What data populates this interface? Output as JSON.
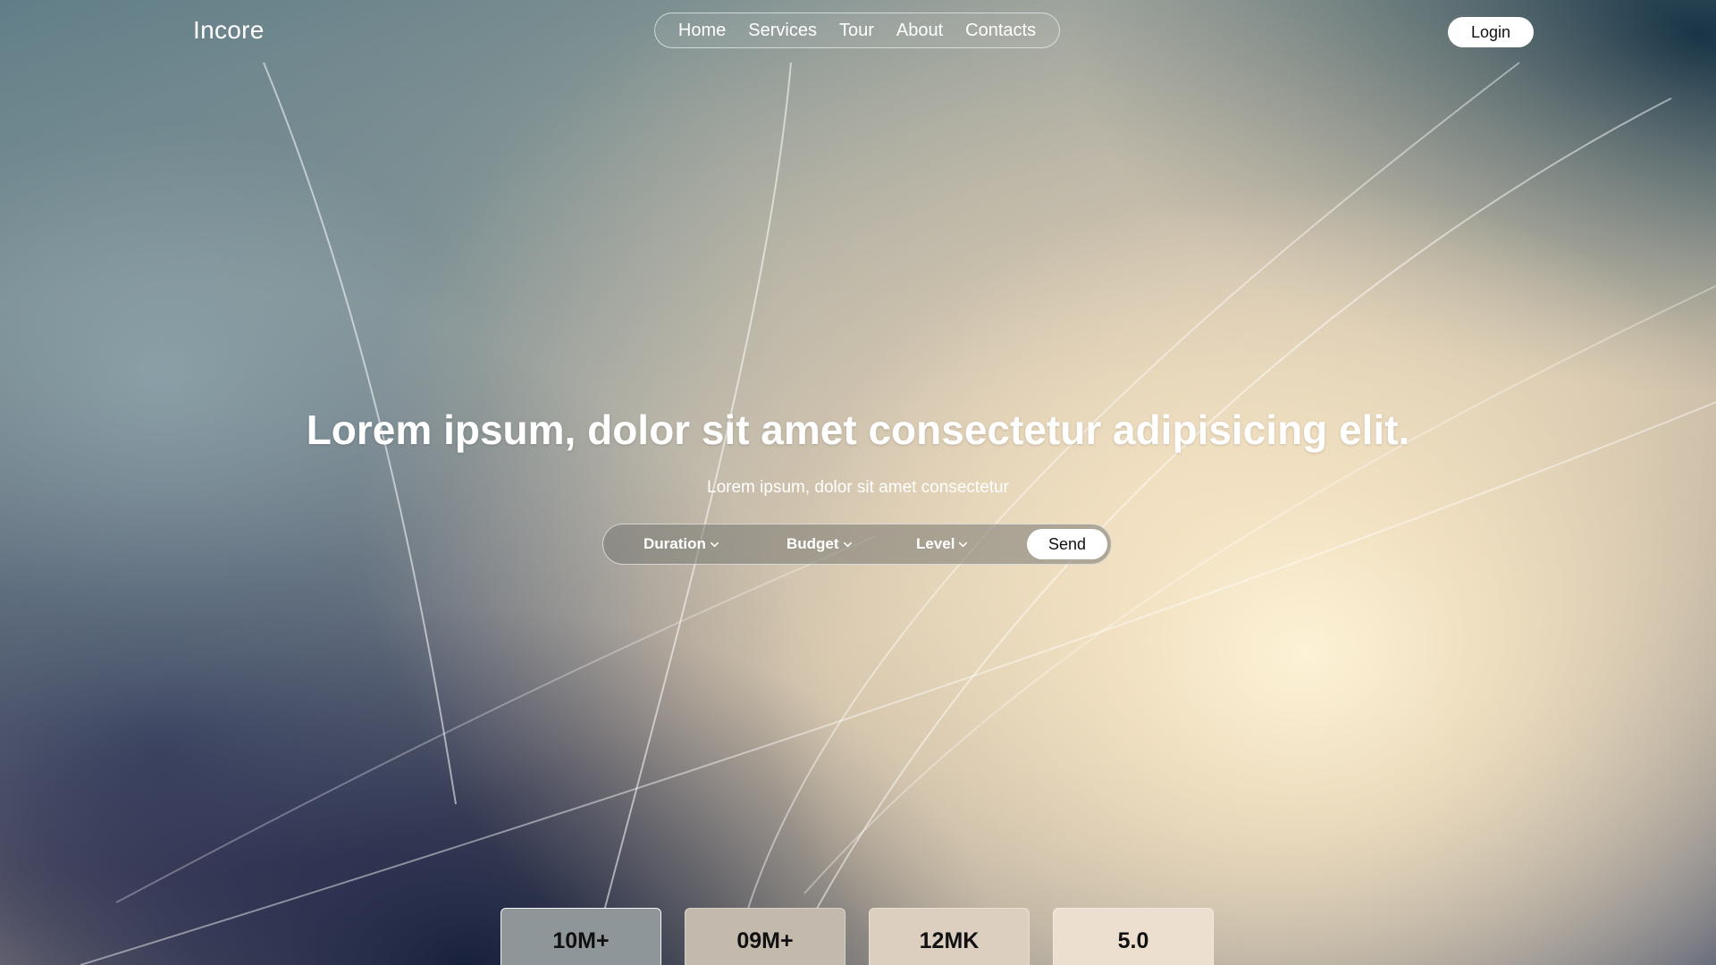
{
  "brand": {
    "logo_text": "Incore"
  },
  "nav": {
    "items": [
      {
        "label": "Home"
      },
      {
        "label": "Services"
      },
      {
        "label": "Tour"
      },
      {
        "label": "About"
      },
      {
        "label": "Contacts"
      }
    ],
    "login_label": "Login"
  },
  "hero": {
    "title": "Lorem ipsum, dolor sit amet consectetur adipisicing elit.",
    "subtitle": "Lorem ipsum, dolor sit amet consectetur"
  },
  "search": {
    "filters": [
      {
        "label": "Duration",
        "icon": "chevron-down-icon"
      },
      {
        "label": "Budget",
        "icon": "chevron-down-icon"
      },
      {
        "label": "Level",
        "icon": "chevron-down-icon"
      }
    ],
    "send_label": "Send"
  },
  "stats": [
    {
      "value": "10M+"
    },
    {
      "value": "09M+"
    },
    {
      "value": "12MK"
    },
    {
      "value": "5.0"
    }
  ],
  "colors": {
    "text_light": "#ffffff",
    "button_bg": "#ffffff",
    "button_text": "#111111"
  }
}
